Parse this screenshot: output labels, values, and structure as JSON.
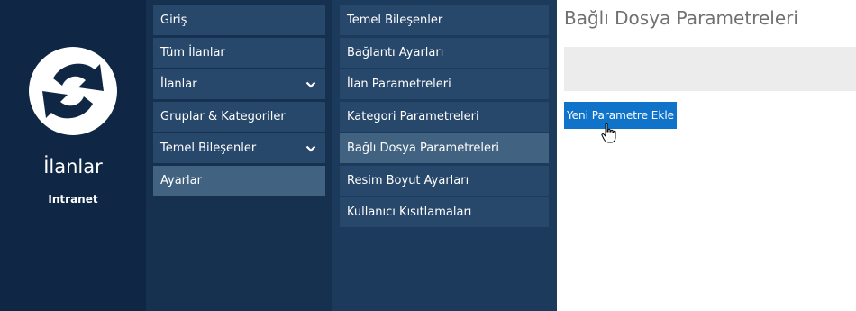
{
  "brand": {
    "app_name": "İlanlar",
    "subtitle": "Intranet",
    "logo_icon": "refresh-arrow-logo"
  },
  "nav_primary": {
    "items": [
      {
        "label": "Giriş"
      },
      {
        "label": "Tüm İlanlar"
      },
      {
        "label": "İlanlar",
        "has_submenu": true
      },
      {
        "label": "Gruplar & Kategoriler"
      },
      {
        "label": "Temel Bileşenler",
        "has_submenu": true
      },
      {
        "label": "Ayarlar",
        "active": true
      }
    ]
  },
  "nav_secondary": {
    "items": [
      {
        "label": "Temel Bileşenler"
      },
      {
        "label": "Bağlantı Ayarları"
      },
      {
        "label": "İlan Parametreleri"
      },
      {
        "label": "Kategori Parametreleri"
      },
      {
        "label": "Bağlı Dosya Parametreleri",
        "active": true
      },
      {
        "label": "Resim Boyut Ayarları"
      },
      {
        "label": "Kullanıcı Kısıtlamaları"
      }
    ]
  },
  "content": {
    "title": "Bağlı Dosya Parametreleri",
    "add_button_label": "Yeni Parametre Ekle"
  },
  "colors": {
    "brand_bg": "#0f2744",
    "nav_primary_bg": "#16314f",
    "nav_secondary_bg": "#1c3a5c",
    "nav_item_bg": "#28486b",
    "nav_item_active_bg": "#426282",
    "button_bg": "#0f73c9"
  }
}
